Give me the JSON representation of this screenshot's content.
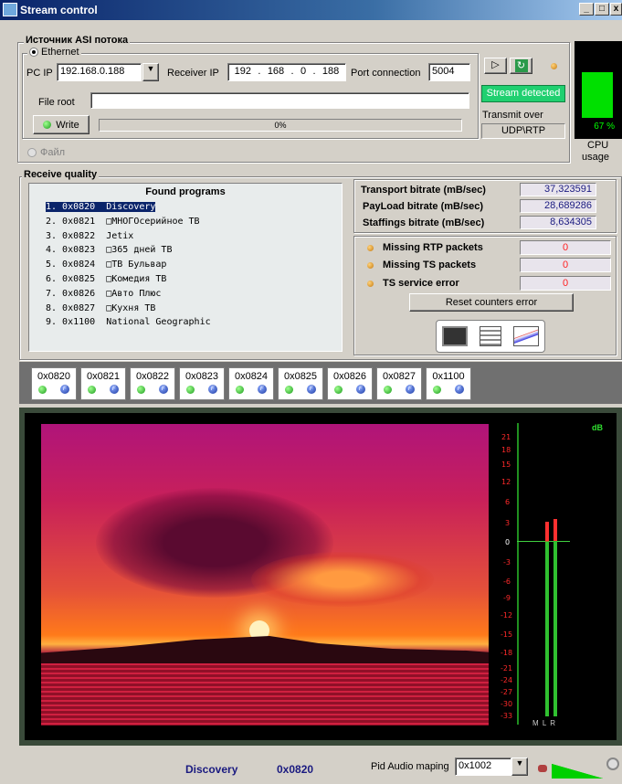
{
  "window": {
    "title": "Stream control"
  },
  "source": {
    "group_label": "Источник ASI потока",
    "ethernet_label": "Ethernet",
    "file_label": "Файл",
    "pc_ip_label": "PC IP",
    "pc_ip_value": "192.168.0.188",
    "receiver_ip_label": "Receiver IP",
    "receiver_ip": [
      "192",
      "168",
      "0",
      "188"
    ],
    "port_label": "Port connection",
    "port_value": "5004",
    "file_root_label": "File root",
    "write_label": "Write",
    "progress_text": "0%",
    "stream_status": "Stream detected",
    "transmit_label": "Transmit over",
    "transmit_value": "UDP\\RTP"
  },
  "cpu": {
    "value": "67 %",
    "label_1": "CPU",
    "label_2": "usage",
    "level": 0.67
  },
  "quality": {
    "group_label": "Receive  quality",
    "programs_header": "Found programs",
    "programs": [
      "1. 0x0820  Discovery",
      "2. 0x0821  □МНОГОсерийное ТВ",
      "3. 0x0822  Jetix",
      "4. 0x0823  □365 дней ТВ",
      "5. 0x0824  □ТВ Бульвар",
      "6. 0x0825  □Комедия ТВ",
      "7. 0x0826  □Авто Плюс",
      "8. 0x0827  □Кухня ТВ",
      "9. 0x1100  National Geographic"
    ],
    "bitrates": [
      {
        "label": "Transport bitrate  (mB/sec)",
        "value": "37,323591"
      },
      {
        "label": "PayLoad bitrate  (mB/sec)",
        "value": "28,689286"
      },
      {
        "label": "Staffings bitrate  (mB/sec)",
        "value": "8,634305"
      }
    ],
    "errors": [
      {
        "label": "Missing RTP packets",
        "value": "0"
      },
      {
        "label": "Missing TS  packets",
        "value": "0"
      },
      {
        "label": "TS service error",
        "value": "0"
      }
    ],
    "reset_label": "Reset counters error"
  },
  "tabs": [
    "0x0820",
    "0x0821",
    "0x0822",
    "0x0823",
    "0x0824",
    "0x0825",
    "0x0826",
    "0x0827",
    "0x1100"
  ],
  "meter": {
    "unit": "dB",
    "ticks": [
      "21",
      "18",
      "15",
      "12",
      "6",
      "3",
      "0",
      "-3",
      "-6",
      "-9",
      "-12",
      "-15",
      "-18",
      "-21",
      "-24",
      "-27",
      "-30",
      "-33"
    ],
    "channels": "M L R"
  },
  "footer": {
    "program_name": "Discovery",
    "pid": "0x0820",
    "audio_label": "Pid Audio maping",
    "audio_value": "0x1002"
  }
}
